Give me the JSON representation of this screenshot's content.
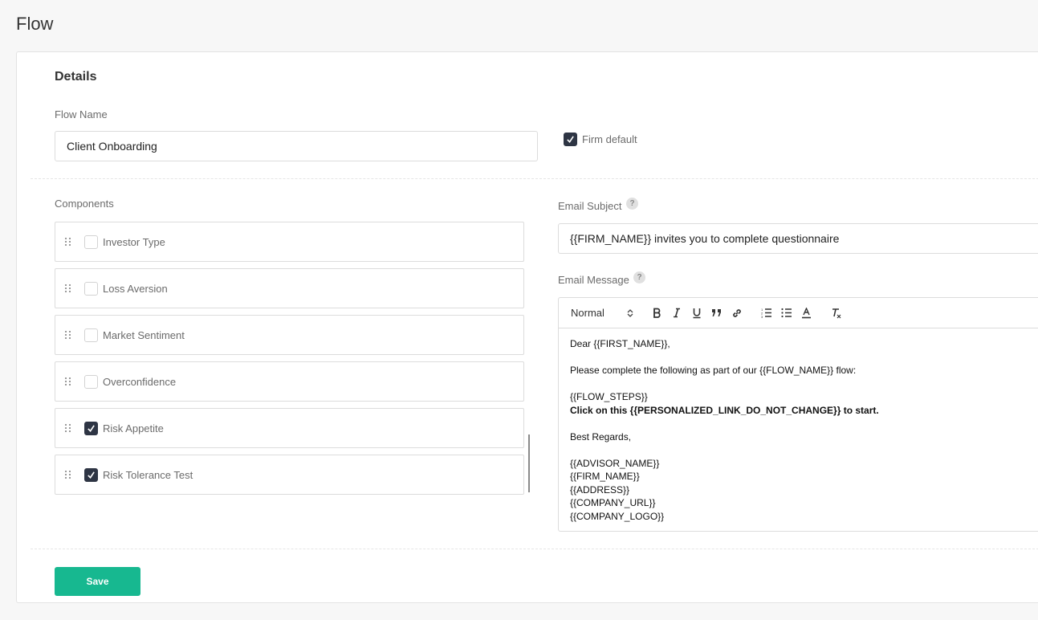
{
  "page": {
    "title": "Flow"
  },
  "details": {
    "section_title": "Details",
    "flow_name_label": "Flow Name",
    "flow_name_value": "Client Onboarding",
    "firm_default_label": "Firm default",
    "firm_default_checked": true
  },
  "components": {
    "label": "Components",
    "items": [
      {
        "label": "Investor Type",
        "checked": false
      },
      {
        "label": "Loss Aversion",
        "checked": false
      },
      {
        "label": "Market Sentiment",
        "checked": false
      },
      {
        "label": "Overconfidence",
        "checked": false
      },
      {
        "label": "Risk Appetite",
        "checked": true
      },
      {
        "label": "Risk Tolerance Test",
        "checked": true
      }
    ]
  },
  "email": {
    "subject_label": "Email Subject",
    "subject_value": "{{FIRM_NAME}} invites you to complete questionnaire",
    "message_label": "Email Message",
    "help_glyph": "?",
    "toolbar": {
      "format_select": "Normal",
      "buttons": [
        "bold-icon",
        "italic-icon",
        "underline-icon",
        "blockquote-icon",
        "link-icon",
        "ordered-list-icon",
        "bullet-list-icon",
        "text-color-icon",
        "clear-format-icon"
      ]
    },
    "body": {
      "greeting": "Dear {{FIRST_NAME}},",
      "intro": "Please complete the following as part of our {{FLOW_NAME}} flow:",
      "steps": "{{FLOW_STEPS}}",
      "link_line": "Click on this {{PERSONALIZED_LINK_DO_NOT_CHANGE}} to start.",
      "regards": "Best Regards,",
      "advisor": "{{ADVISOR_NAME}}",
      "firm": "{{FIRM_NAME}}",
      "address": "{{ADDRESS}}",
      "company_url": "{{COMPANY_URL}}",
      "company_logo": "{{COMPANY_LOGO}}"
    }
  },
  "actions": {
    "save_label": "Save"
  },
  "colors": {
    "accent": "#17b890",
    "checkbox_checked": "#2e3544"
  }
}
